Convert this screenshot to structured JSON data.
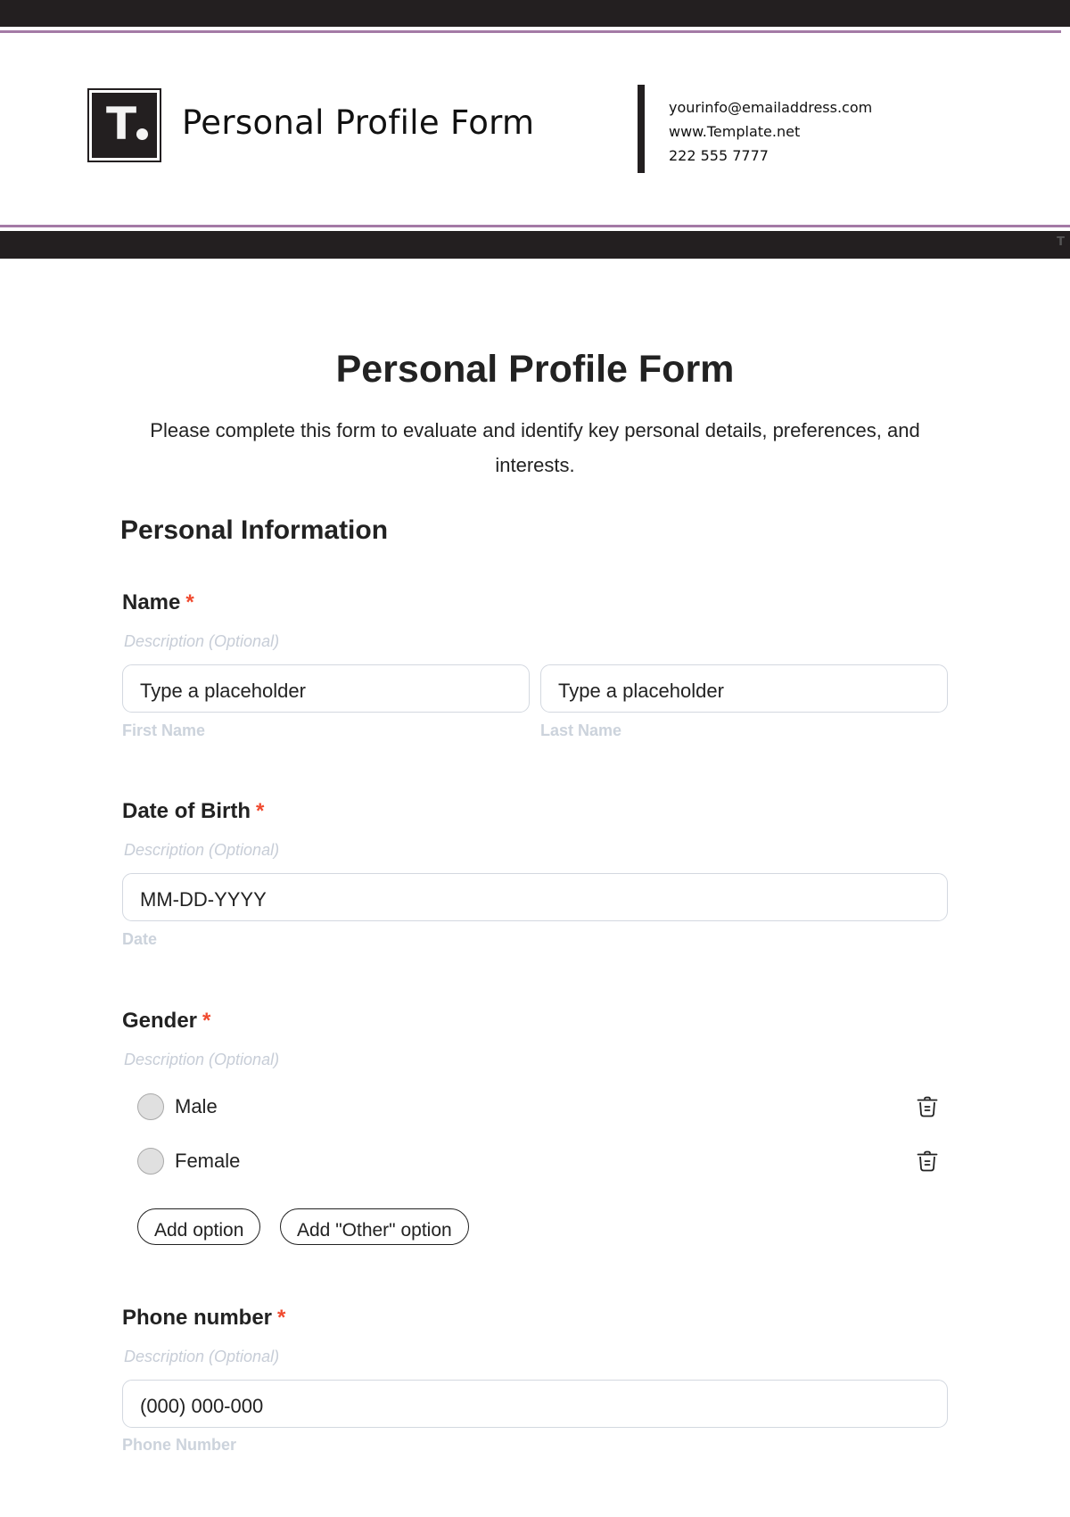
{
  "letterhead": {
    "logo_letter": "T",
    "title": "Personal Profile Form",
    "contact": {
      "email": "yourinfo@emailaddress.com",
      "website": "www.Template.net",
      "phone": "222 555 7777"
    },
    "corner_mark": "T",
    "accent_color": "#a47aa6",
    "bar_color": "#231f20"
  },
  "form": {
    "title": "Personal Profile Form",
    "description": "Please complete this form to evaluate and identify key personal details, preferences, and interests.",
    "section_title": "Personal Information",
    "required_marker": "*",
    "required_color": "#f04a2f",
    "fields": {
      "name": {
        "label": "Name",
        "description": "Description (Optional)",
        "first": {
          "value": "Type a placeholder",
          "sublabel": "First Name"
        },
        "last": {
          "value": "Type a placeholder",
          "sublabel": "Last Name"
        }
      },
      "dob": {
        "label": "Date of Birth",
        "description": "Description (Optional)",
        "value": "MM-DD-YYYY",
        "sublabel": "Date"
      },
      "gender": {
        "label": "Gender",
        "description": "Description (Optional)",
        "options": [
          {
            "label": "Male",
            "selected": false
          },
          {
            "label": "Female",
            "selected": false
          }
        ],
        "add_option_label": "Add option",
        "add_other_label": "Add \"Other\" option"
      },
      "phone": {
        "label": "Phone number",
        "description": "Description (Optional)",
        "value": "(000) 000-000",
        "sublabel": "Phone Number"
      }
    }
  }
}
